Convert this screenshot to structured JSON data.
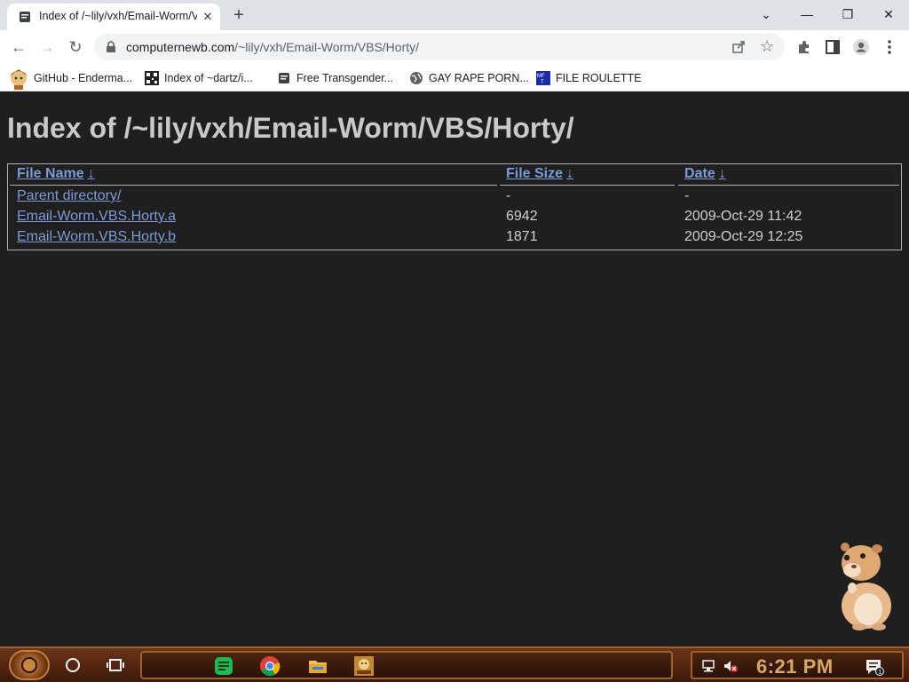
{
  "browser": {
    "tab": {
      "title": "Index of /~lily/vxh/Email-Worm/VBS/Horty/",
      "close_glyph": "✕"
    },
    "new_tab_glyph": "+",
    "window_controls": {
      "minimize": "—",
      "restore": "❐",
      "close": "✕",
      "tabsearch": "⌄"
    },
    "nav": {
      "back": "←",
      "forward": "→",
      "reload": "↻"
    },
    "url": {
      "host": "computernewb.com",
      "path": "/~lily/vxh/Email-Worm/VBS/Horty/"
    },
    "star_glyph": "☆"
  },
  "bookmarks": [
    {
      "label": "GitHub - Enderma...",
      "icon": "anime-avatar-icon"
    },
    {
      "label": "Index of ~dartz/i...",
      "icon": "qr-icon"
    },
    {
      "label": "Free Transgender...",
      "icon": "page-icon"
    },
    {
      "label": "GAY RAPE PORN...",
      "icon": "globe-icon"
    },
    {
      "label": "FILE ROULETTE",
      "icon": "mft-icon"
    }
  ],
  "page": {
    "heading": "Index of /~lily/vxh/Email-Worm/VBS/Horty/",
    "columns": {
      "name": "File Name",
      "size": "File Size",
      "date": "Date",
      "sort_arrow": "↓"
    },
    "rows": [
      {
        "name": "Parent directory/",
        "size": "-",
        "date": "-"
      },
      {
        "name": "Email-Worm.VBS.Horty.a",
        "size": "6942",
        "date": "2009-Oct-29 11:42"
      },
      {
        "name": "Email-Worm.VBS.Horty.b",
        "size": "1871",
        "date": "2009-Oct-29 12:25"
      }
    ]
  },
  "taskbar": {
    "clock": "6:21 PM",
    "notification_badge": "1",
    "colors": {
      "accent": "#a0622c",
      "clock": "#d8a766"
    }
  },
  "colors": {
    "page_bg": "#1f1f1f",
    "link": "#7b9bd9",
    "heading": "#c9c9c9"
  }
}
